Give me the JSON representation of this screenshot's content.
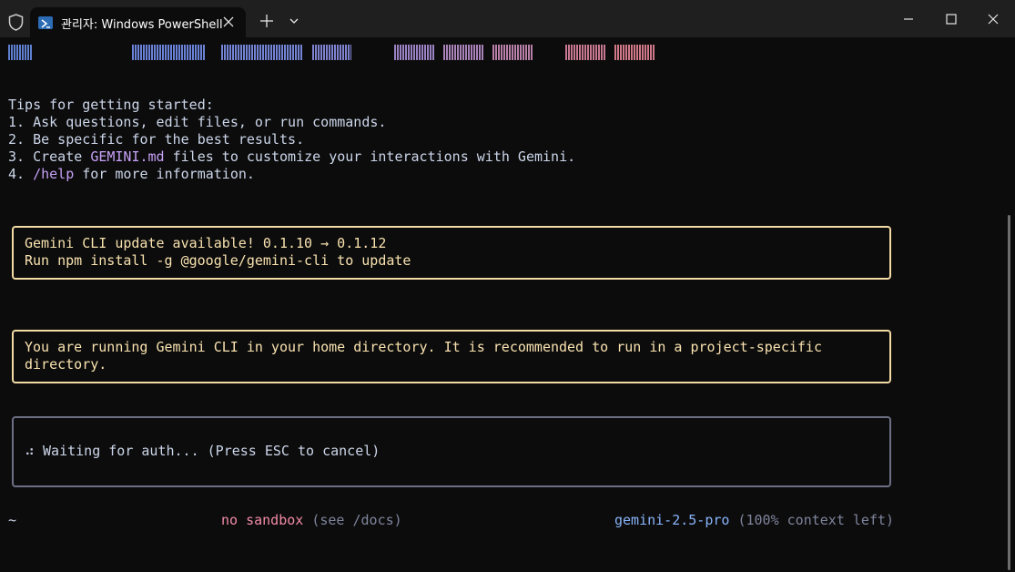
{
  "window": {
    "tab_title": "관리자: Windows PowerShell"
  },
  "terminal": {
    "tips": {
      "heading": "Tips for getting started:",
      "items": [
        {
          "prefix": "1. ",
          "accent": "",
          "text": "Ask questions, edit files, or run commands."
        },
        {
          "prefix": "2. ",
          "accent": "",
          "text": "Be specific for the best results."
        },
        {
          "prefix": "3. Create ",
          "accent": "GEMINI.md",
          "text": " files to customize your interactions with Gemini."
        },
        {
          "prefix": "4. ",
          "accent": "/help",
          "text": " for more information."
        }
      ]
    },
    "update_box": {
      "line1": "Gemini CLI update available! 0.1.10 → 0.1.12",
      "line2": "Run npm install -g @google/gemini-cli to update"
    },
    "warning_box": {
      "line1": "You are running Gemini CLI in your home directory. It is recommended to run in a project-specific",
      "line2": "directory."
    },
    "auth_box": {
      "spinner": "⠴",
      "text": "Waiting for auth... (Press ESC to cancel)"
    },
    "status_bar": {
      "cwd": "~",
      "sandbox": "no sandbox",
      "sandbox_hint": "(see /docs)",
      "model": "gemini-2.5-pro",
      "context": "(100% context left)"
    }
  },
  "colors": {
    "accent": "#c6a0f6",
    "warning_border": "#f4dba4",
    "sandbox": "#f38ba8",
    "model": "#89b4fa"
  }
}
